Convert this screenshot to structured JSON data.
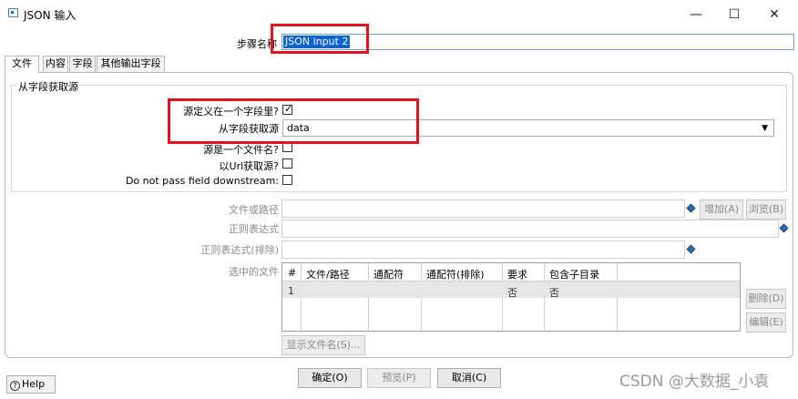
{
  "window": {
    "title": "JSON 输入",
    "minimize": "—",
    "maximize": "☐",
    "close": "✕"
  },
  "step": {
    "label": "步骤名称",
    "value": "JSON input 2"
  },
  "tabs": [
    {
      "label": "文件",
      "active": true
    },
    {
      "label": "内容",
      "active": false
    },
    {
      "label": "字段",
      "active": false
    },
    {
      "label": "其他输出字段",
      "active": false
    }
  ],
  "source_group": {
    "title": "从字段获取源",
    "defined_in_field_label": "源定义在一个字段里?",
    "defined_in_field_checked": true,
    "get_source_label": "从字段获取源",
    "get_source_value": "data",
    "is_filename_label": "源是一个文件名?",
    "from_url_label": "以Url获取源?",
    "do_not_pass_label": "Do not pass field downstream:"
  },
  "file_section": {
    "file_path_label": "文件或路径",
    "add_button": "增加(A)",
    "browse_button": "浏览(B)",
    "regex_label": "正则表达式",
    "regex_exclude_label": "正则表达式(排除)",
    "selected_files_label": "选中的文件",
    "delete_button": "删除(D)",
    "edit_button": "编辑(E)",
    "show_filenames_button": "显示文件名(S)..."
  },
  "file_table": {
    "columns": [
      "#",
      "文件/路径",
      "通配符",
      "通配符(排除)",
      "要求",
      "包含子目录"
    ],
    "rows": [
      [
        "1",
        "",
        "",
        "",
        "否",
        "否"
      ]
    ]
  },
  "footer": {
    "help": "Help",
    "ok": "确定(O)",
    "preview": "预览(P)",
    "cancel": "取消(C)"
  },
  "watermark": "CSDN @大数据_小袁",
  "colors": {
    "highlight_box": "#e0141c",
    "selection": "#0a64d0"
  }
}
